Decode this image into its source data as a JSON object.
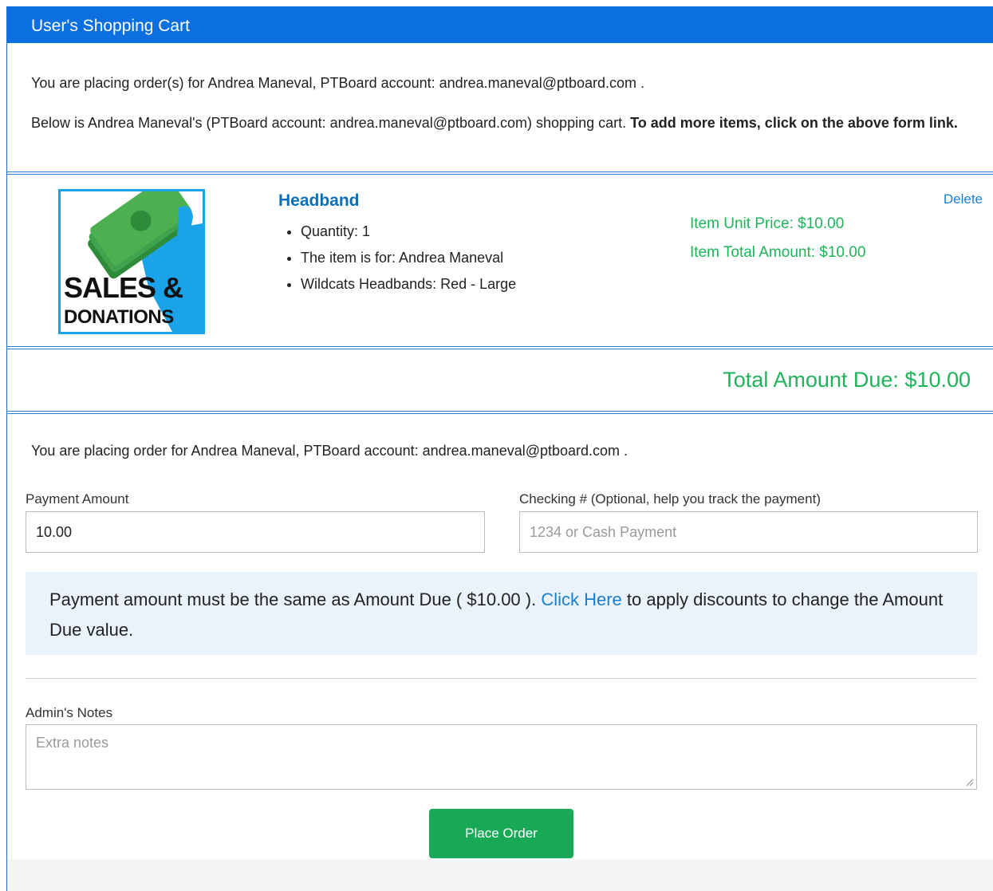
{
  "header": {
    "title": "User's Shopping Cart"
  },
  "intro": {
    "line1": "You are placing order(s) for Andrea Maneval, PTBoard account: andrea.maneval@ptboard.com .",
    "line2_plain": "Below is Andrea Maneval's (PTBoard account: andrea.maneval@ptboard.com) shopping cart. ",
    "line2_bold": "To add more items, click on the above form link."
  },
  "cart_item": {
    "image_text_top": "SALES &",
    "image_text_bottom": "DONATIONS",
    "name": "Headband",
    "details": [
      "Quantity: 1",
      "The item is for: Andrea Maneval",
      "Wildcats Headbands: Red - Large"
    ],
    "delete_label": "Delete",
    "unit_price": "Item Unit Price: $10.00",
    "total_amount": "Item Total Amount: $10.00"
  },
  "total_due": "Total Amount Due: $10.00",
  "payment": {
    "placing_line": "You are placing order for Andrea Maneval, PTBoard account: andrea.maneval@ptboard.com .",
    "amount_label": "Payment Amount",
    "amount_value": "10.00",
    "check_label": "Checking # (Optional, help you track the payment)",
    "check_placeholder": "1234 or Cash Payment",
    "alert_before": "Payment amount must be the same as Amount Due ( $10.00 ). ",
    "alert_link": "Click Here",
    "alert_after": " to apply discounts to change the Amount Due value.",
    "notes_label": "Admin's Notes",
    "notes_placeholder": "Extra notes",
    "submit_label": "Place Order"
  },
  "colors": {
    "header_bg": "#0b6fe0",
    "price_green": "#1fb35a",
    "link_blue": "#1a7fd0",
    "button_green": "#18a957"
  }
}
